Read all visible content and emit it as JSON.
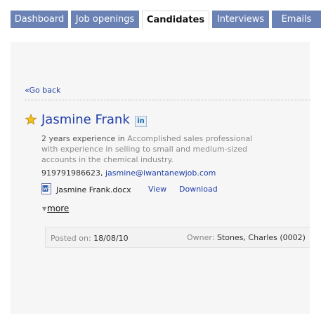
{
  "tabs": [
    {
      "label": "Dashboard"
    },
    {
      "label": "Job openings"
    },
    {
      "label": "Candidates"
    },
    {
      "label": "Interviews"
    },
    {
      "label": "Emails"
    }
  ],
  "active_tab": "Candidates",
  "nav": {
    "back_label": "«Go back"
  },
  "candidate": {
    "name": "Jasmine Frank",
    "starred": true,
    "linkedin_badge": "in",
    "experience": "2 years experience in",
    "summary": "Accomplished sales professional with experience in selling to small and medium-sized accounts in the chemical industry.",
    "phone": "919791986623,",
    "email": "jasmine@iwantanewjob.com",
    "resume": {
      "filename": "Jasmine Frank.docx",
      "view_label": "View",
      "download_label": "Download"
    },
    "more_label": "more",
    "posted_label": "Posted on:",
    "posted_on": "18/08/10",
    "owner_label": "Owner:",
    "owner": "Stones, Charles (0002)"
  },
  "colors": {
    "tab_bg": "#6b82b5",
    "link": "#1f3ea8",
    "star": "#f2c21b",
    "panel_bg": "#f6f6f6"
  },
  "icons": [
    "star-icon",
    "linkedin-icon",
    "word-doc-icon",
    "caret-down-icon"
  ]
}
